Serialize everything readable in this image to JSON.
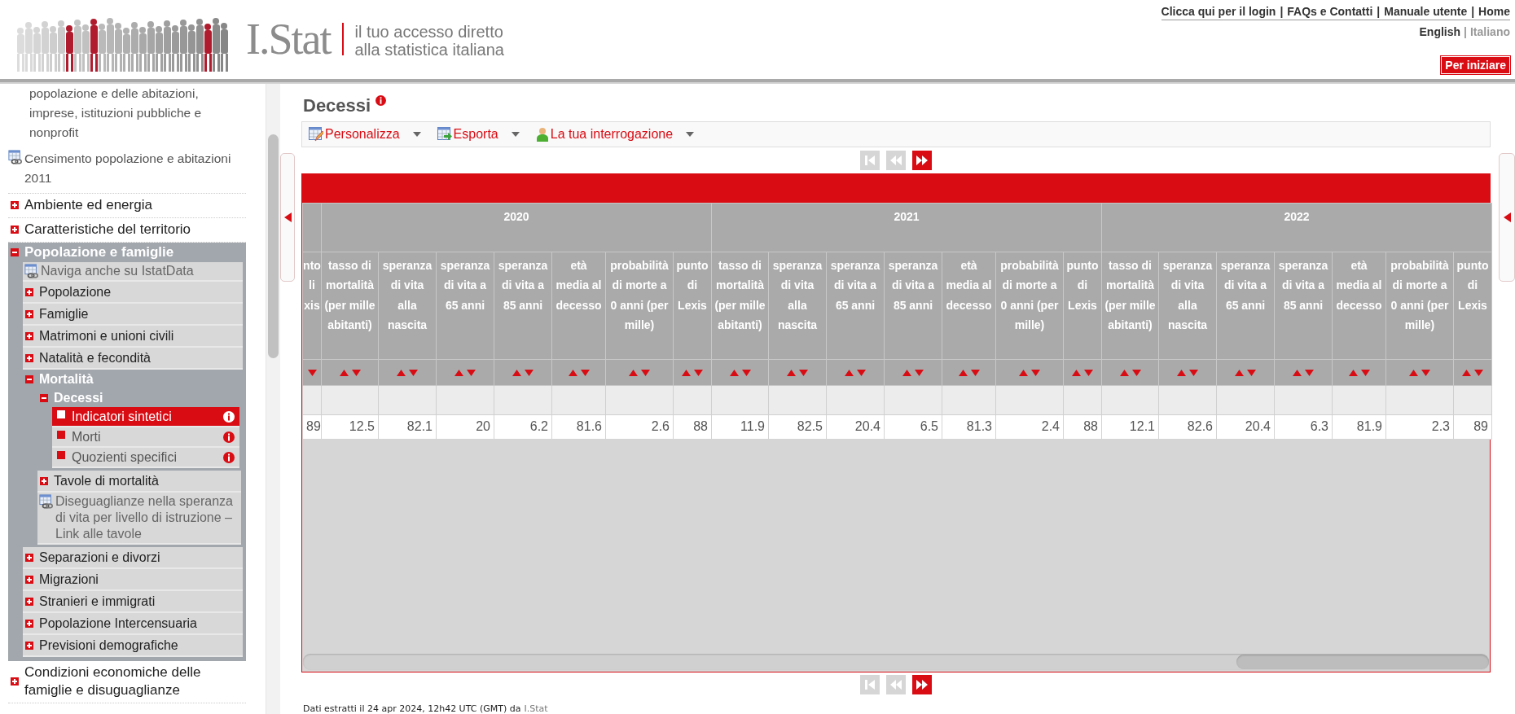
{
  "header": {
    "logo": "I.Stat",
    "tagline": [
      "il tuo accesso diretto",
      "alla statistica italiana"
    ],
    "links": [
      "Clicca qui per il login",
      "FAQs e Contatti",
      "Manuale utente",
      "Home"
    ],
    "separator": "|",
    "languages": [
      {
        "label": "English",
        "selected": true
      },
      {
        "label": "Italiano",
        "selected": false
      }
    ],
    "start_button": "Per iniziare"
  },
  "sidebar": {
    "items": [
      {
        "kind": "text",
        "label": "popolazione e delle abitazioni, imprese, istituzioni pubbliche e nonprofit"
      },
      {
        "kind": "link",
        "label": "Censimento popolazione e abitazioni 2011"
      },
      {
        "kind": "node",
        "label": "Ambiente ed energia",
        "expanded": false
      },
      {
        "kind": "node",
        "label": "Caratteristiche del territorio",
        "expanded": false
      },
      {
        "kind": "node",
        "label": "Popolazione e famiglie",
        "expanded": true,
        "children": [
          {
            "kind": "link",
            "label": "Naviga anche su IstatData"
          },
          {
            "kind": "node",
            "label": "Popolazione",
            "expanded": false
          },
          {
            "kind": "node",
            "label": "Famiglie",
            "expanded": false
          },
          {
            "kind": "node",
            "label": "Matrimoni e unioni civili",
            "expanded": false
          },
          {
            "kind": "node",
            "label": "Natalità e fecondità",
            "expanded": false
          },
          {
            "kind": "node",
            "label": "Mortalità",
            "expanded": true,
            "children": [
              {
                "kind": "node",
                "label": "Decessi",
                "expanded": true,
                "children": [
                  {
                    "kind": "leaf",
                    "label": "Indicatori sintetici",
                    "selected": true
                  },
                  {
                    "kind": "leaf",
                    "label": "Morti",
                    "selected": false
                  },
                  {
                    "kind": "leaf",
                    "label": "Quozienti specifici",
                    "selected": false
                  }
                ]
              },
              {
                "kind": "node",
                "label": "Tavole di mortalità",
                "expanded": false
              },
              {
                "kind": "link",
                "label": "Diseguaglianze nella speranza di vita per livello di istruzione – Link alle tavole"
              }
            ]
          },
          {
            "kind": "node",
            "label": "Separazioni e divorzi",
            "expanded": false
          },
          {
            "kind": "node",
            "label": "Migrazioni",
            "expanded": false
          },
          {
            "kind": "node",
            "label": "Stranieri e immigrati",
            "expanded": false
          },
          {
            "kind": "node",
            "label": "Popolazione Intercensuaria",
            "expanded": false
          },
          {
            "kind": "node",
            "label": "Previsioni demografiche",
            "expanded": false
          }
        ]
      },
      {
        "kind": "node",
        "label": "Condizioni economiche delle famiglie e disuguaglianze",
        "expanded": false
      }
    ]
  },
  "page": {
    "title": "Decessi",
    "toolbar": [
      {
        "kind": "customize",
        "label": "Personalizza"
      },
      {
        "kind": "export",
        "label": "Esporta"
      },
      {
        "kind": "query",
        "label": "La tua interrogazione"
      }
    ],
    "pager": [
      {
        "kind": "first",
        "disabled": true
      },
      {
        "kind": "previous",
        "disabled": true
      },
      {
        "kind": "next",
        "disabled": false
      }
    ],
    "table": {
      "partial_column": {
        "header": "nto li xis",
        "value": "89"
      },
      "groups": [
        {
          "year": "2020",
          "columns": [
            "tasso di mortalità (per mille abitanti)",
            "speranza di vita alla nascita",
            "speranza di vita a 65 anni",
            "speranza di vita a 85 anni",
            "età media al decesso",
            "probabilità di morte a 0 anni (per mille)",
            "punto di Lexis"
          ],
          "values": [
            "12.5",
            "82.1",
            "20",
            "6.2",
            "81.6",
            "2.6",
            "88"
          ]
        },
        {
          "year": "2021",
          "columns": [
            "tasso di mortalità (per mille abitanti)",
            "speranza di vita alla nascita",
            "speranza di vita a 65 anni",
            "speranza di vita a 85 anni",
            "età media al decesso",
            "probabilità di morte a 0 anni (per mille)",
            "punto di Lexis"
          ],
          "values": [
            "11.9",
            "82.5",
            "20.4",
            "6.5",
            "81.3",
            "2.4",
            "88"
          ]
        },
        {
          "year": "2022",
          "columns": [
            "tasso di mortalità (per mille abitanti)",
            "speranza di vita alla nascita",
            "speranza di vita a 65 anni",
            "speranza di vita a 85 anni",
            "età media al decesso",
            "probabilità di morte a 0 anni (per mille)",
            "punto di Lexis"
          ],
          "values": [
            "12.1",
            "82.6",
            "20.4",
            "6.3",
            "81.9",
            "2.3",
            "89"
          ]
        }
      ]
    },
    "footer": {
      "text": "Dati estratti il 24 apr 2024, 12h42 UTC (GMT) da",
      "link": "I.Stat"
    }
  }
}
